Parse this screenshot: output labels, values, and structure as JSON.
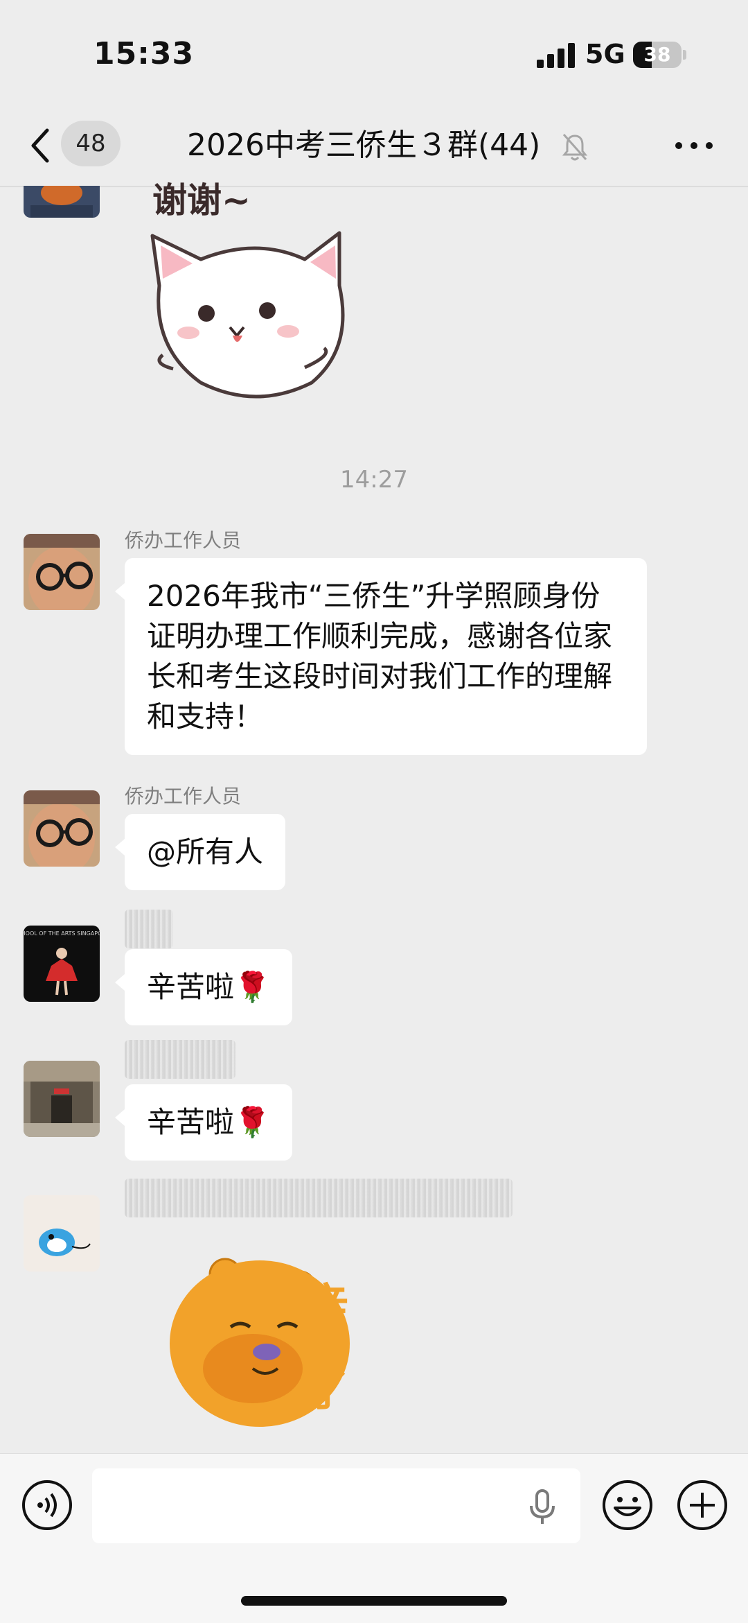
{
  "status_bar": {
    "time": "15:33",
    "network": "5G",
    "battery_level": "38",
    "battery_fraction": 0.38
  },
  "header": {
    "unread_count": "48",
    "title": "2026中考三侨生３群(44)"
  },
  "messages": [
    {
      "type": "sticker",
      "caption": "谢谢~"
    },
    {
      "type": "time",
      "text": "14:27"
    },
    {
      "type": "text",
      "sender": "侨办工作人员",
      "text": "2026年我市“三侨生”升学照顾身份证明办理工作顺利完成，感谢各位家长和考生这段时间对我们工作的理解和支持！"
    },
    {
      "type": "text",
      "sender": "侨办工作人员",
      "text": "@所有人"
    },
    {
      "type": "text",
      "sender": "",
      "text": "辛苦啦🌹"
    },
    {
      "type": "text",
      "sender": "",
      "text": "辛苦啦🌹"
    },
    {
      "type": "sticker",
      "sender": "",
      "caption": "辛苦了"
    }
  ],
  "avatars": {
    "user1_badge": "SCHOOL OF THE ARTS SINGAPORE"
  },
  "colors": {
    "background": "#ededed",
    "bubble": "#ffffff",
    "input_bar": "#f6f6f6",
    "timestamp": "#9d9d9d",
    "sender_name": "#7f7f7f"
  },
  "icons": {
    "back": "chevron-left-icon",
    "mute": "bell-off-icon",
    "more": "more-dots-icon",
    "voice": "voice-wave-icon",
    "mic": "microphone-icon",
    "emoji": "smiley-icon",
    "plus": "plus-circle-icon"
  }
}
